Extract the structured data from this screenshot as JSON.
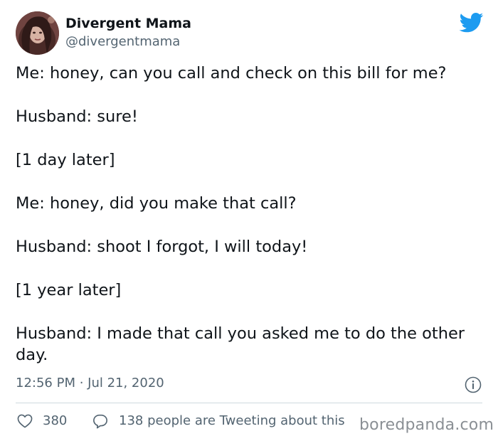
{
  "author": {
    "name": "Divergent Mama",
    "handle": "@divergentmama"
  },
  "tweet": {
    "lines": [
      "Me: honey, can you call and check on this bill for me?",
      "Husband: sure!",
      "[1 day later]",
      "Me: honey, did you make that call?",
      "Husband: shoot I forgot, I will today!",
      "[1 year later]",
      "Husband: I made that call you asked me to do the other day."
    ],
    "timestamp": "12:56 PM · Jul 21, 2020"
  },
  "footer": {
    "like_count": "380",
    "retweeting_text": "138 people are Tweeting about this"
  },
  "watermark": "boredpanda.com",
  "colors": {
    "twitter_blue": "#1d9bf0",
    "secondary_text": "#536471",
    "primary_text": "#0f1419"
  },
  "icons": {
    "brand": "twitter-bird-icon",
    "info": "info-icon",
    "like": "heart-icon",
    "reply": "speech-bubble-icon"
  }
}
